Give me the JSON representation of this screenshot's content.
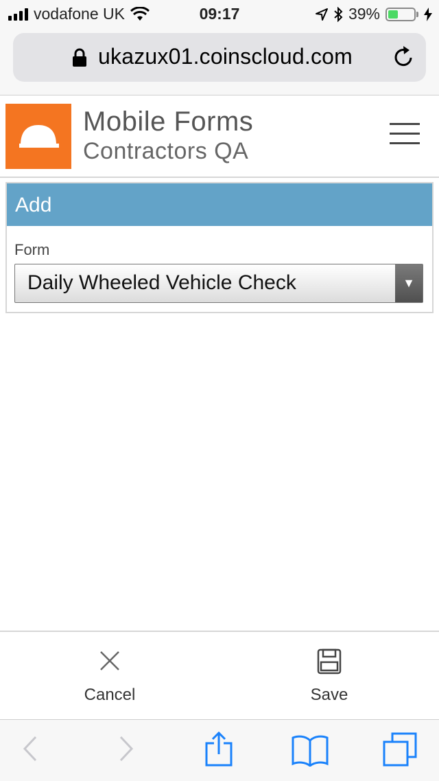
{
  "status_bar": {
    "carrier": "vodafone UK",
    "time": "09:17",
    "battery_percent": "39%",
    "battery_level": 0.39,
    "battery_color": "#4cd964"
  },
  "browser": {
    "url": "ukazux01.coinscloud.com",
    "icons": [
      "lock-icon",
      "reload-icon",
      "back-icon",
      "forward-icon",
      "share-icon",
      "bookmarks-icon",
      "tabs-icon"
    ]
  },
  "header": {
    "title": "Mobile Forms",
    "subtitle": "Contractors QA",
    "logo_color": "#f47521",
    "logo_icon": "hard-hat-icon",
    "menu_icon": "hamburger-menu-icon"
  },
  "panel": {
    "heading": "Add",
    "heading_color": "#63a3c8",
    "form_label": "Form",
    "form_value": "Daily Wheeled Vehicle Check"
  },
  "actions": {
    "cancel_label": "Cancel",
    "save_label": "Save"
  }
}
